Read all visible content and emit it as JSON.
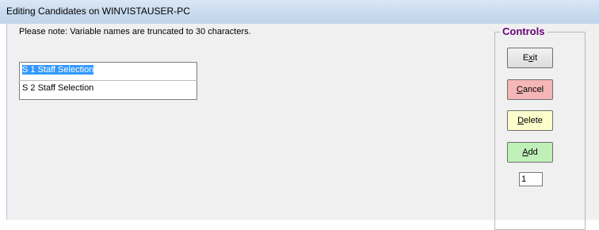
{
  "window": {
    "title": "Editing Candidates on WINVISTAUSER-PC"
  },
  "note": "Please note: Variable names are truncated to 30 characters.",
  "candidates": [
    {
      "label": "S 1 Staff Selection",
      "selected": true
    },
    {
      "label": "S 2 Staff Selection",
      "selected": false
    }
  ],
  "controls": {
    "legend": "Controls",
    "exit": {
      "before": "E",
      "accel": "x",
      "after": "it"
    },
    "cancel": {
      "before": "",
      "accel": "C",
      "after": "ancel"
    },
    "delete": {
      "before": "",
      "accel": "D",
      "after": "elete"
    },
    "add": {
      "before": "",
      "accel": "A",
      "after": "dd"
    },
    "count_value": "1"
  },
  "colors": {
    "cancel": "#f4b6b6",
    "delete": "#fcfccc",
    "add": "#bff0b8",
    "legend": "#6a007a",
    "selection": "#3399ff"
  }
}
